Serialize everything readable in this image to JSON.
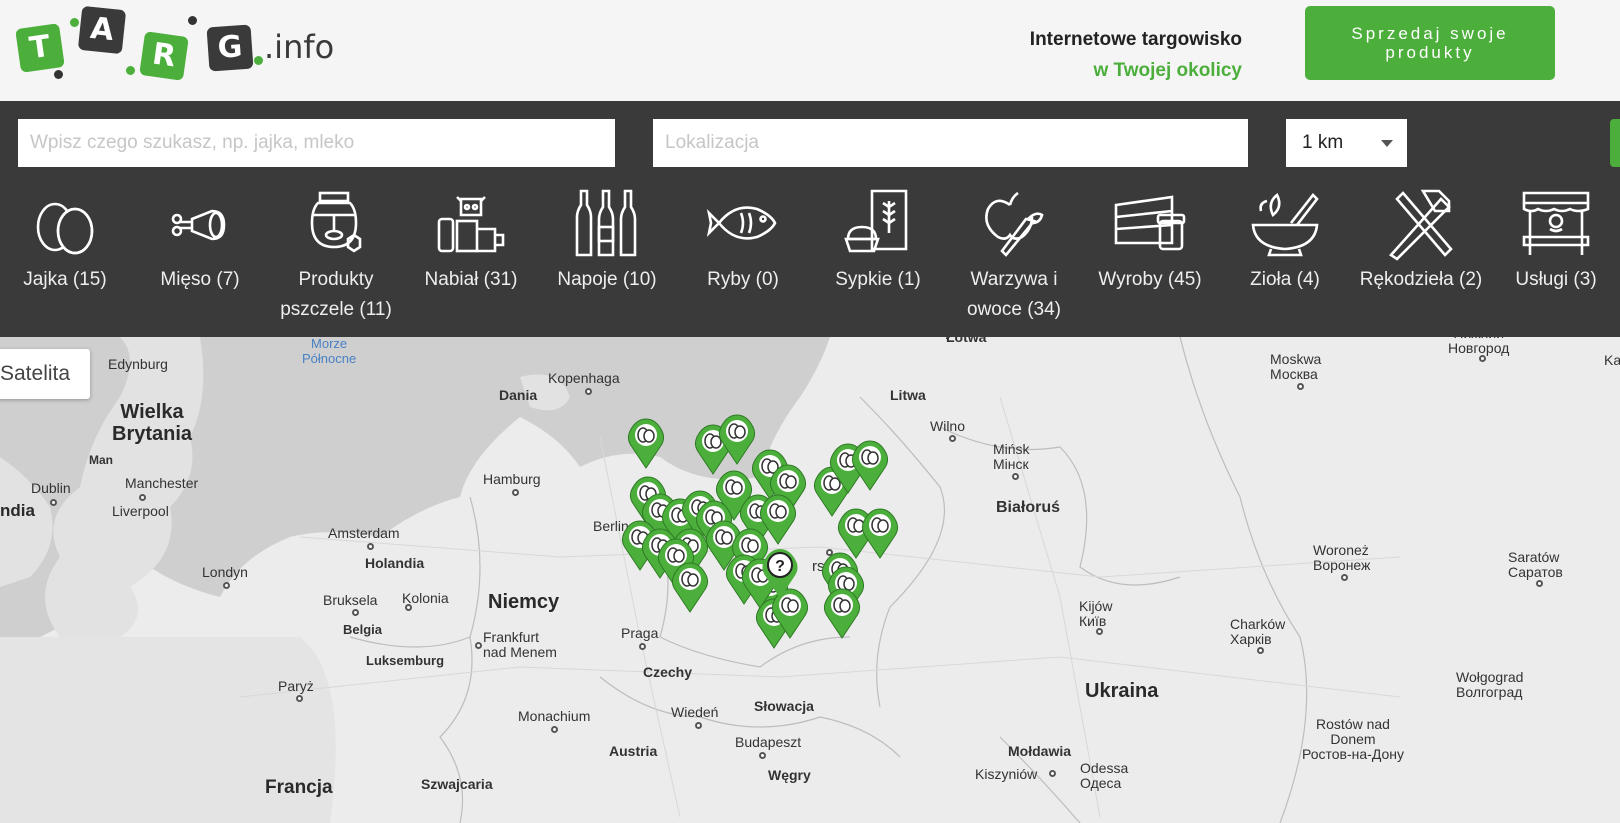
{
  "header": {
    "logo_letters": [
      "T",
      "A",
      "R",
      "G"
    ],
    "logo_suffix": ".info",
    "tagline_line1": "Internetowe targowisko",
    "tagline_line2": "w Twojej okolicy",
    "sell_button_label": "Sprzedaj swoje\nprodukty"
  },
  "search": {
    "query_placeholder": "Wpisz czego szukasz, np. jajka, mleko",
    "query_value": "",
    "location_placeholder": "Lokalizacja",
    "location_value": "",
    "radius_selected": "1 km"
  },
  "categories": [
    {
      "label": "Jajka (15)",
      "icon": "eggs-icon"
    },
    {
      "label": "Mięso (7)",
      "icon": "meat-icon"
    },
    {
      "label": "Produkty pszczele (11)",
      "icon": "honey-jar-icon"
    },
    {
      "label": "Nabiał (31)",
      "icon": "dairy-cow-icon"
    },
    {
      "label": "Napoje (10)",
      "icon": "bottles-icon"
    },
    {
      "label": "Ryby (0)",
      "icon": "fish-icon"
    },
    {
      "label": "Sypkie (1)",
      "icon": "grain-sack-icon"
    },
    {
      "label": "Warzywa i owoce (34)",
      "icon": "apple-carrot-icon"
    },
    {
      "label": "Wyroby (45)",
      "icon": "cake-jar-icon"
    },
    {
      "label": "Zioła (4)",
      "icon": "mortar-herbs-icon"
    },
    {
      "label": "Rękodzieła (2)",
      "icon": "crafts-tools-icon"
    },
    {
      "label": "Usługi (3)",
      "icon": "market-stall-icon"
    }
  ],
  "map": {
    "satellite_button": "Satelita",
    "labels": {
      "edynburg": "Edynburg",
      "wielka_brytania": "Wielka\nBrytania",
      "man": "Man",
      "dublin": "Dublin",
      "irlandia": "ndia",
      "manchester": "Manchester",
      "liverpool": "Liverpool",
      "londyn": "Londyn",
      "morze": "Morze\nPółnocne",
      "amsterdam": "Amsterdam",
      "holandia": "Holandia",
      "bruksela": "Bruksela",
      "belgia": "Belgia",
      "kolonia": "Kolonia",
      "luksemburg": "Luksemburg",
      "paryz": "Paryż",
      "francja": "Francja",
      "dania": "Dania",
      "kopenhaga": "Kopenhaga",
      "hamburg": "Hamburg",
      "berlin": "Berlin",
      "niemcy": "Niemcy",
      "frankfurt": "Frankfurt\nnad Menem",
      "praga": "Praga",
      "czechy": "Czechy",
      "monachium": "Monachium",
      "szwajcaria": "Szwajcaria",
      "austria": "Austria",
      "wieden": "Wiedeń",
      "slowacja": "Słowacja",
      "budapeszt": "Budapeszt",
      "wegry": "Węgry",
      "warszawa": "rszaw",
      "lotwa": "Łotwa",
      "litwa": "Litwa",
      "wilno": "Wilno",
      "minsk": "Mińsk\nМінск",
      "bialorus": "Białoruś",
      "kijow": "Kijów\nКиїв",
      "ukraina": "Ukraina",
      "moldawia": "Mołdawia",
      "kiszyniow": "Kiszyniów",
      "odessa": "Odessa\nОдеса",
      "moskwa": "Moskwa\nМосква",
      "nizhny": "Нижний\nНовгород",
      "woronez": "Woroneż\nВоронеж",
      "charkow": "Charków\nХарків",
      "saratow": "Saratów\nСаратов",
      "wolgograd": "Wołgograd\nВолгоград",
      "rostow": "Rostów nad\nDonem\nРостов-на-Дону",
      "edge_k": "Ka"
    }
  },
  "colors": {
    "brand_green": "#4caf3c",
    "toolbar_dark": "#3a3a3a"
  }
}
